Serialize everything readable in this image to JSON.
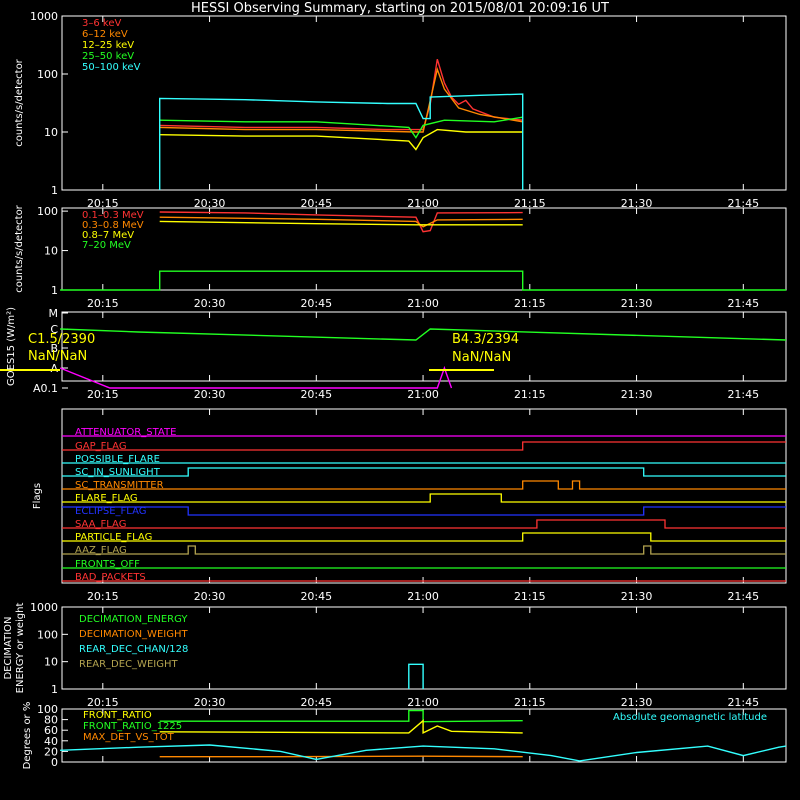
{
  "title": "HESSI Observing Summary, starting on 2015/08/01 20:09:16 UT",
  "time_ticks": [
    "20:15",
    "20:30",
    "20:45",
    "21:00",
    "21:15",
    "21:30",
    "21:45"
  ],
  "colors": {
    "red": "#ff3333",
    "orange": "#ff8800",
    "yellow": "#ffff00",
    "green": "#22ff22",
    "cyan": "#33ffff",
    "magenta": "#ff00ff",
    "blue": "#2233ff",
    "olive": "#b3a34f",
    "axis": "#ffffff"
  },
  "chart_data": [
    {
      "id": "panel1",
      "type": "line",
      "ylabel": "counts/s/detector",
      "yscale": "log",
      "ylim": [
        1,
        1000
      ],
      "yticks": [
        "1",
        "10",
        "100",
        "1000"
      ],
      "xlim": [
        "20:09:16",
        "21:51:00"
      ],
      "legend": [
        {
          "label": "3–6 keV",
          "color": "#ff3333"
        },
        {
          "label": "6–12 keV",
          "color": "#ff8800"
        },
        {
          "label": "12–25 keV",
          "color": "#ffff00"
        },
        {
          "label": "25–50 keV",
          "color": "#22ff22"
        },
        {
          "label": "50–100 keV",
          "color": "#33ffff"
        }
      ],
      "series": [
        {
          "name": "3–6 keV",
          "color": "#ff3333",
          "points": [
            [
              "20:23",
              13
            ],
            [
              "20:35",
              12
            ],
            [
              "20:45",
              12
            ],
            [
              "20:55",
              11
            ],
            [
              "20:59",
              11
            ],
            [
              "21:00",
              11
            ],
            [
              "21:01",
              30
            ],
            [
              "21:02",
              180
            ],
            [
              "21:03",
              70
            ],
            [
              "21:04",
              40
            ],
            [
              "21:05",
              30
            ],
            [
              "21:06",
              35
            ],
            [
              "21:07",
              25
            ],
            [
              "21:10",
              18
            ],
            [
              "21:14",
              16
            ]
          ]
        },
        {
          "name": "6–12 keV",
          "color": "#ff8800",
          "points": [
            [
              "20:23",
              12
            ],
            [
              "20:35",
              11
            ],
            [
              "20:45",
              11
            ],
            [
              "20:59",
              10
            ],
            [
              "21:00",
              10
            ],
            [
              "21:02",
              120
            ],
            [
              "21:03",
              55
            ],
            [
              "21:05",
              26
            ],
            [
              "21:08",
              20
            ],
            [
              "21:14",
              15
            ]
          ]
        },
        {
          "name": "12–25 keV",
          "color": "#ffff00",
          "points": [
            [
              "20:23",
              9
            ],
            [
              "20:35",
              8.5
            ],
            [
              "20:45",
              8.5
            ],
            [
              "20:58",
              7
            ],
            [
              "20:59",
              5
            ],
            [
              "21:00",
              8
            ],
            [
              "21:02",
              11
            ],
            [
              "21:06",
              10
            ],
            [
              "21:14",
              10
            ]
          ]
        },
        {
          "name": "25–50 keV",
          "color": "#22ff22",
          "points": [
            [
              "20:23",
              16
            ],
            [
              "20:35",
              15
            ],
            [
              "20:45",
              15
            ],
            [
              "20:58",
              12
            ],
            [
              "20:59",
              8
            ],
            [
              "21:00",
              13
            ],
            [
              "21:03",
              16
            ],
            [
              "21:10",
              15
            ],
            [
              "21:14",
              18
            ]
          ]
        },
        {
          "name": "50–100 keV",
          "color": "#33ffff",
          "points": [
            [
              "20:23",
              1
            ],
            [
              "20:23",
              38
            ],
            [
              "20:35",
              36
            ],
            [
              "20:45",
              33
            ],
            [
              "20:55",
              31
            ],
            [
              "20:59",
              31
            ],
            [
              "21:00",
              17
            ],
            [
              "21:01",
              17
            ],
            [
              "21:01",
              40
            ],
            [
              "21:08",
              43
            ],
            [
              "21:14",
              45
            ],
            [
              "21:14",
              1
            ]
          ]
        }
      ]
    },
    {
      "id": "panel2",
      "type": "line",
      "ylabel": "counts/s/detector",
      "yscale": "log",
      "ylim": [
        1,
        120
      ],
      "yticks": [
        "1",
        "10",
        "100"
      ],
      "legend": [
        {
          "label": "0.1–0.3 MeV",
          "color": "#ff3333"
        },
        {
          "label": "0.3–0.8 MeV",
          "color": "#ff8800"
        },
        {
          "label": "0.8–7 MeV",
          "color": "#ffff00"
        },
        {
          "label": "7–20 MeV",
          "color": "#22ff22"
        }
      ],
      "series": [
        {
          "name": "0.1–0.3 MeV",
          "color": "#ff3333",
          "points": [
            [
              "20:23",
              95
            ],
            [
              "20:35",
              90
            ],
            [
              "20:45",
              80
            ],
            [
              "20:59",
              70
            ],
            [
              "21:00",
              30
            ],
            [
              "21:01",
              32
            ],
            [
              "21:02",
              90
            ],
            [
              "21:14",
              92
            ]
          ]
        },
        {
          "name": "0.3–0.8 MeV",
          "color": "#ff8800",
          "points": [
            [
              "20:23",
              70
            ],
            [
              "20:45",
              62
            ],
            [
              "20:59",
              55
            ],
            [
              "21:00",
              40
            ],
            [
              "21:02",
              60
            ],
            [
              "21:14",
              62
            ]
          ]
        },
        {
          "name": "0.8–7 MeV",
          "color": "#ffff00",
          "points": [
            [
              "20:23",
              55
            ],
            [
              "20:45",
              48
            ],
            [
              "20:59",
              45
            ],
            [
              "21:02",
              45
            ],
            [
              "21:14",
              45
            ]
          ]
        },
        {
          "name": "7–20 MeV",
          "color": "#22ff22",
          "points": [
            [
              "20:09",
              1
            ],
            [
              "20:23",
              1
            ],
            [
              "20:23",
              3
            ],
            [
              "21:14",
              3
            ],
            [
              "21:14",
              1
            ],
            [
              "21:51",
              1
            ]
          ]
        }
      ]
    },
    {
      "id": "panel3",
      "type": "line",
      "ylabel": "GOES15 (W/m²)",
      "yticks": [
        "M",
        "C",
        "B",
        "A",
        "A0.1"
      ],
      "annotations": [
        {
          "text": "C1.5/2390",
          "time": "20:14"
        },
        {
          "text": "NaN/NaN",
          "time": "20:13"
        },
        {
          "text": "B4.3/2394",
          "time": "21:02"
        },
        {
          "text": "NaN/NaN",
          "time": "21:05"
        }
      ],
      "series": [
        {
          "name": "GOES long",
          "color": "#22ff22",
          "points": [
            [
              "20:09",
              "C"
            ],
            [
              "20:20",
              "C-"
            ],
            [
              "20:59",
              "B+"
            ],
            [
              "21:01",
              "C"
            ],
            [
              "21:51",
              "B+"
            ]
          ]
        },
        {
          "name": "GOES short",
          "color": "#ff00ff",
          "points": [
            [
              "20:09",
              "A"
            ],
            [
              "20:16",
              "A0.1"
            ],
            [
              "21:02",
              "A0.1"
            ],
            [
              "21:03",
              "A"
            ],
            [
              "21:04",
              "A0.1"
            ]
          ]
        }
      ]
    },
    {
      "id": "panel4",
      "type": "flags",
      "ylabel": "Flags",
      "flags": [
        {
          "name": "ATTENUATOR_STATE",
          "color": "#ff00ff",
          "transitions": []
        },
        {
          "name": "GAP_FLAG",
          "color": "#ff3333",
          "transitions": [
            [
              "21:14",
              1
            ]
          ]
        },
        {
          "name": "POSSIBLE_FLARE",
          "color": "#33ffff",
          "transitions": []
        },
        {
          "name": "SC_IN_SUNLIGHT",
          "color": "#33ffff",
          "transitions": [
            [
              "20:27",
              1
            ],
            [
              "21:31",
              0
            ]
          ]
        },
        {
          "name": "SC_TRANSMITTER",
          "color": "#ff8800",
          "transitions": [
            [
              "21:14",
              1
            ],
            [
              "21:19",
              0
            ],
            [
              "21:21",
              1
            ],
            [
              "21:22",
              0
            ]
          ]
        },
        {
          "name": "FLARE_FLAG",
          "color": "#ffff00",
          "transitions": [
            [
              "21:01",
              1
            ],
            [
              "21:11",
              0
            ]
          ]
        },
        {
          "name": "ECLIPSE_FLAG",
          "color": "#2233ff",
          "transitions": [
            [
              "20:27",
              0
            ],
            [
              "21:31",
              1
            ]
          ]
        },
        {
          "name": "SAA_FLAG",
          "color": "#ff3333",
          "transitions": [
            [
              "21:16",
              1
            ],
            [
              "21:34",
              0
            ]
          ]
        },
        {
          "name": "PARTICLE_FLAG",
          "color": "#ffff00",
          "transitions": [
            [
              "21:14",
              1
            ],
            [
              "21:32",
              0
            ]
          ]
        },
        {
          "name": "AAZ_FLAG",
          "color": "#b3a34f",
          "transitions": [
            [
              "20:27",
              1
            ],
            [
              "20:28",
              0
            ],
            [
              "21:31",
              1
            ],
            [
              "21:32",
              0
            ]
          ]
        },
        {
          "name": "FRONTS_OFF",
          "color": "#22ff22",
          "transitions": []
        },
        {
          "name": "BAD_PACKETS",
          "color": "#ff3333",
          "transitions": []
        }
      ]
    },
    {
      "id": "panel5",
      "type": "line",
      "ylabel": "DECIMATION ENERGY or weight",
      "yscale": "log",
      "ylim": [
        1,
        1000
      ],
      "yticks": [
        "1",
        "10",
        "100",
        "1000"
      ],
      "legend": [
        {
          "label": "DECIMATION_ENERGY",
          "color": "#22ff22"
        },
        {
          "label": "DECIMATION_WEIGHT",
          "color": "#ff8800"
        },
        {
          "label": "REAR_DEC_CHAN/128",
          "color": "#33ffff"
        },
        {
          "label": "REAR_DEC_WEIGHT",
          "color": "#b3a34f"
        }
      ],
      "series": [
        {
          "name": "REAR_DEC_CHAN/128",
          "color": "#33ffff",
          "points": [
            [
              "20:58",
              1
            ],
            [
              "20:58",
              8
            ],
            [
              "21:00",
              8
            ],
            [
              "21:00",
              1
            ]
          ]
        }
      ]
    },
    {
      "id": "panel6",
      "type": "line",
      "ylabel": "Degrees or %",
      "ylim": [
        0,
        100
      ],
      "yticks": [
        "0",
        "20",
        "40",
        "60",
        "80",
        "100"
      ],
      "legend": [
        {
          "label": "FRONT_RATIO",
          "color": "#ffff00"
        },
        {
          "label": "FRONT_RATIO_1225",
          "color": "#22ff22"
        },
        {
          "label": "MAX_DET_VS_TOT",
          "color": "#ff8800"
        }
      ],
      "right_label": "Absolute geomagnetic latitude",
      "series": [
        {
          "name": "FRONT_RATIO_1225",
          "color": "#22ff22",
          "points": [
            [
              "20:23",
              77
            ],
            [
              "20:40",
              77
            ],
            [
              "20:58",
              77
            ],
            [
              "20:58",
              97
            ],
            [
              "21:00",
              97
            ],
            [
              "21:00",
              76
            ],
            [
              "21:14",
              78
            ]
          ]
        },
        {
          "name": "FRONT_RATIO",
          "color": "#ffff00",
          "points": [
            [
              "20:23",
              57
            ],
            [
              "20:40",
              56
            ],
            [
              "20:58",
              55
            ],
            [
              "21:00",
              78
            ],
            [
              "21:00",
              55
            ],
            [
              "21:02",
              68
            ],
            [
              "21:04",
              58
            ],
            [
              "21:14",
              55
            ]
          ]
        },
        {
          "name": "MAX_DET_VS_TOT",
          "color": "#ff8800",
          "points": [
            [
              "20:23",
              10
            ],
            [
              "20:40",
              10
            ],
            [
              "21:00",
              11
            ],
            [
              "21:14",
              10
            ]
          ]
        },
        {
          "name": "Absolute geomagnetic latitude",
          "color": "#33ffff",
          "points": [
            [
              "20:09",
              22
            ],
            [
              "20:20",
              28
            ],
            [
              "20:30",
              32
            ],
            [
              "20:40",
              20
            ],
            [
              "20:45",
              5
            ],
            [
              "20:52",
              22
            ],
            [
              "21:00",
              30
            ],
            [
              "21:10",
              25
            ],
            [
              "21:18",
              12
            ],
            [
              "21:22",
              2
            ],
            [
              "21:30",
              18
            ],
            [
              "21:40",
              30
            ],
            [
              "21:45",
              12
            ],
            [
              "21:50",
              28
            ],
            [
              "21:51",
              30
            ]
          ]
        }
      ]
    }
  ]
}
